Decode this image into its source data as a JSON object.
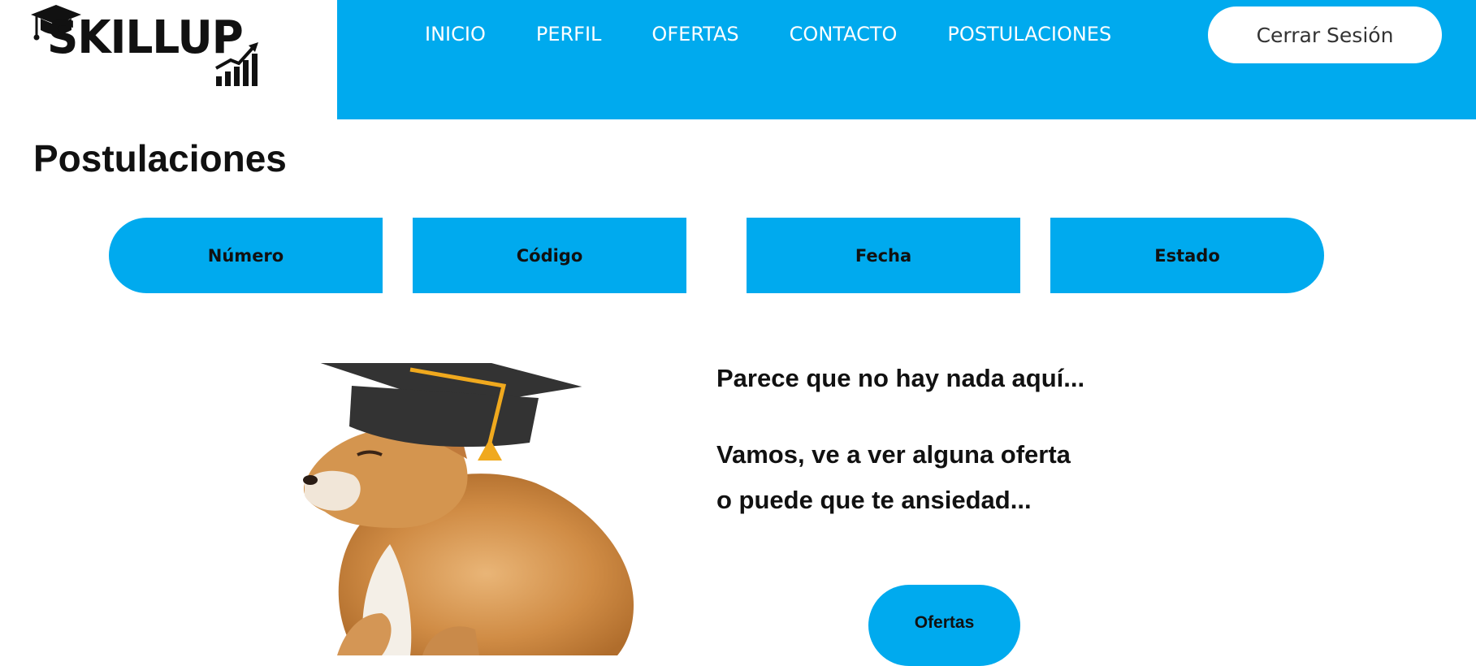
{
  "brand": {
    "logo_text": "SKILLUP"
  },
  "nav": {
    "items": [
      {
        "label": "INICIO"
      },
      {
        "label": "PERFIL"
      },
      {
        "label": "OFERTAS"
      },
      {
        "label": "CONTACTO"
      },
      {
        "label": "POSTULACIONES"
      }
    ],
    "logout_label": "Cerrar Sesión"
  },
  "page": {
    "title": "Postulaciones"
  },
  "table": {
    "headers": [
      "Número",
      "Código",
      "Fecha",
      "Estado"
    ]
  },
  "empty_state": {
    "line1": "Parece que no hay nada aquí...",
    "line2": "Vamos, ve a ver alguna oferta",
    "line3": "o puede que te ansiedad...",
    "button_label": "Ofertas"
  },
  "colors": {
    "accent": "#00aaee",
    "text": "#111111",
    "background": "#ffffff"
  },
  "icons": {
    "logo_cap": "graduation-cap-icon",
    "logo_chart": "growth-chart-icon"
  }
}
